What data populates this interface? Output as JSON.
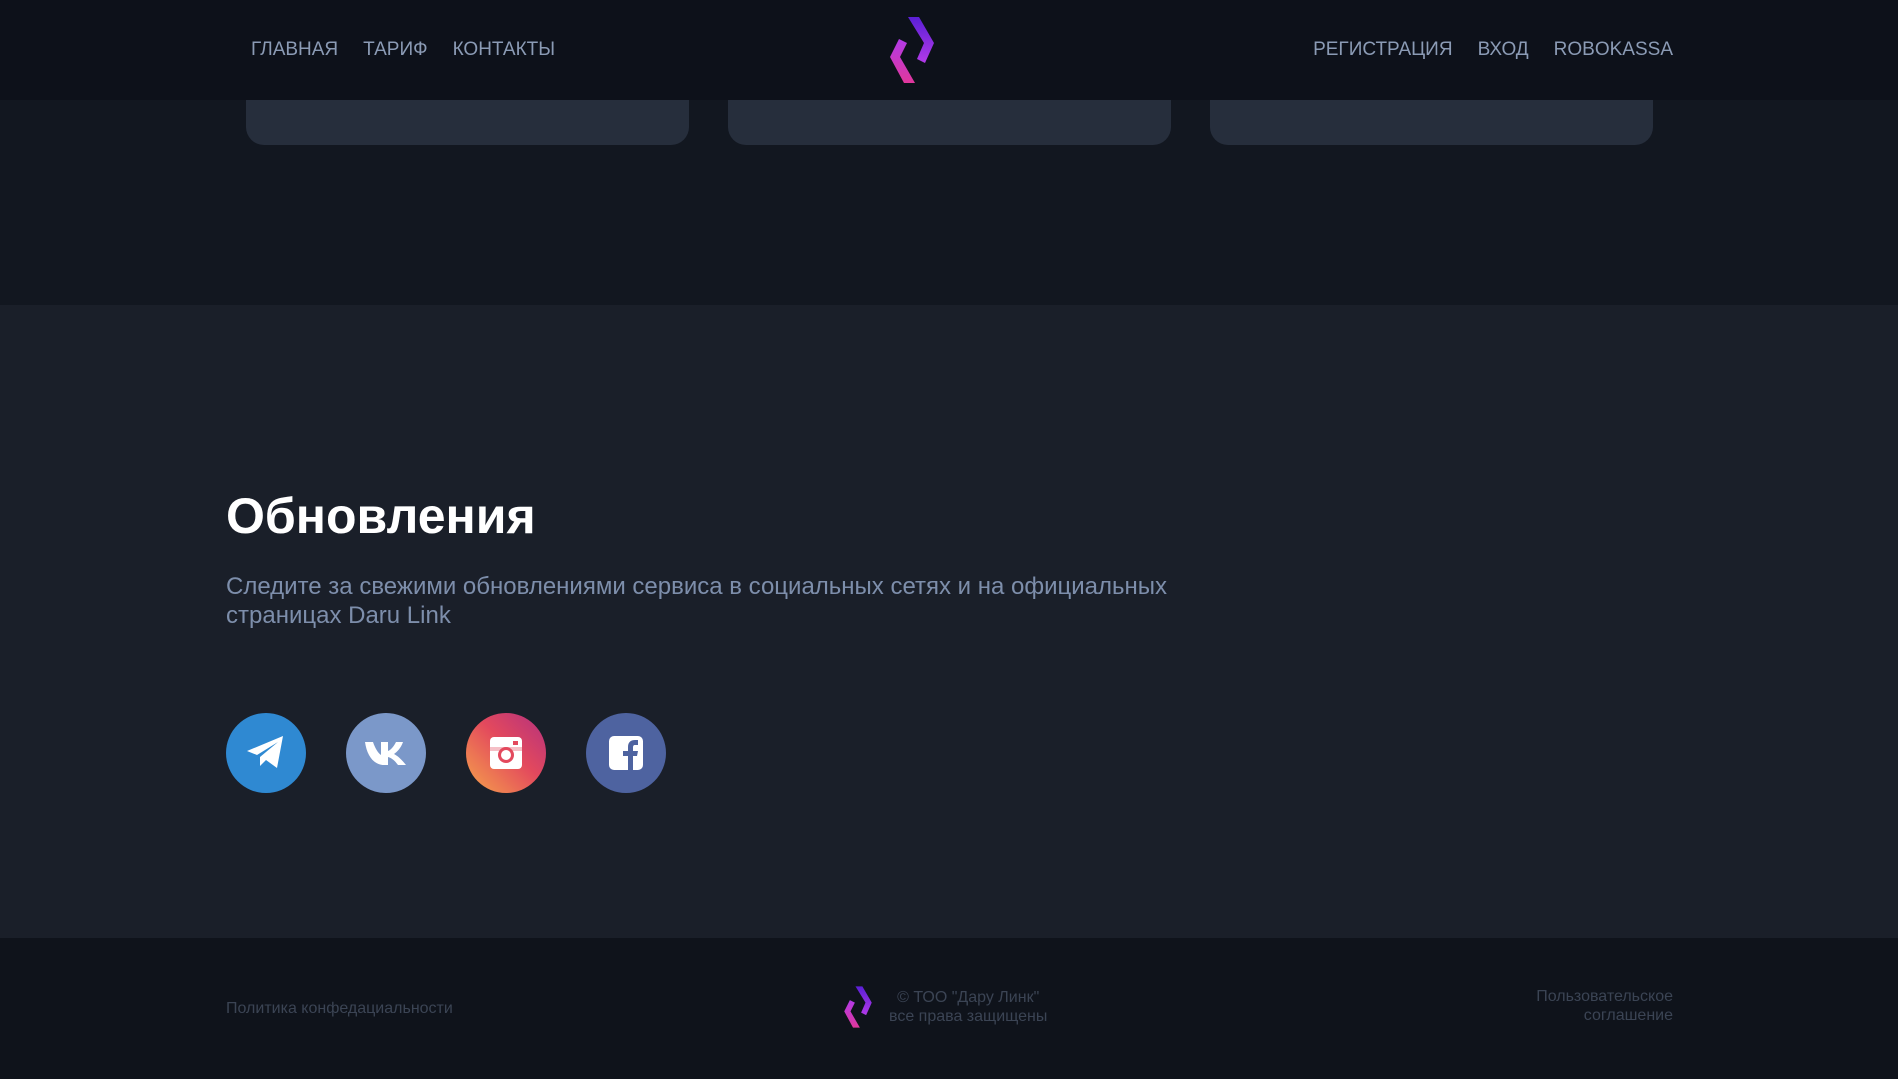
{
  "nav": {
    "left": [
      "ГЛАВНАЯ",
      "ТАРИФ",
      "КОНТАКТЫ"
    ],
    "right": [
      "РЕГИСТРАЦИЯ",
      "ВХОД",
      "ROBOKASSA"
    ]
  },
  "logo_icon": "daru-link-logo-icon",
  "updates": {
    "title": "Обновления",
    "text_line1": "Следите за свежими обновлениями сервиса в социальных сетях и на официальных",
    "text_line2": "страницах Daru Link",
    "socials": [
      {
        "icon": "telegram-icon",
        "color": "#2f89d2"
      },
      {
        "icon": "vk-icon",
        "color": "#7b98c9"
      },
      {
        "icon": "instagram-icon",
        "color": "#e3495d"
      },
      {
        "icon": "facebook-icon",
        "color": "#4e63a0"
      }
    ]
  },
  "footer": {
    "privacy": "Политика конфедациальности",
    "copyright_line1": "© ТОО \"Дару Линк\"",
    "copyright_line2": "все права защищены",
    "agreement_line1": "Пользовательское",
    "agreement_line2": "соглашение"
  },
  "colors": {
    "accent_purple": "#8a2be2",
    "accent_pink": "#e0379c",
    "header_bg": "#0d111a",
    "section_bg": "#1a1f29",
    "text_muted": "#7d8eab"
  }
}
